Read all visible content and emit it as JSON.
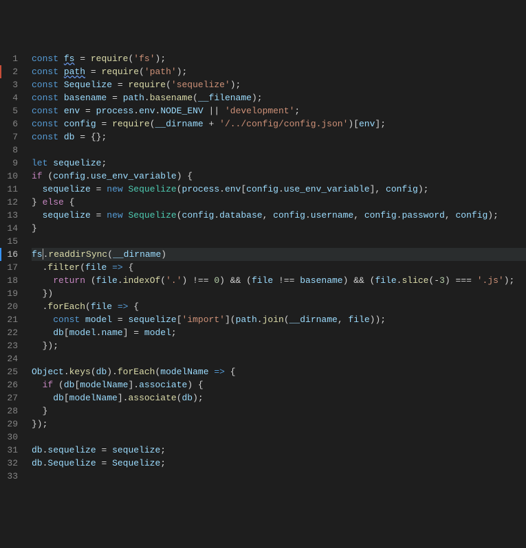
{
  "lines": [
    "1",
    "2",
    "3",
    "4",
    "5",
    "6",
    "7",
    "8",
    "9",
    "10",
    "11",
    "12",
    "13",
    "14",
    "15",
    "16",
    "17",
    "18",
    "19",
    "20",
    "21",
    "22",
    "23",
    "24",
    "25",
    "26",
    "27",
    "28",
    "29",
    "30",
    "31",
    "32",
    "33"
  ],
  "tokens": {
    "kw": {
      "const_": "const",
      "let_": "let",
      "if_": "if",
      "else_": "else",
      "new_": "new",
      "return_": "return"
    },
    "id": {
      "fs": "fs",
      "path": "path",
      "Sequelize": "Sequelize",
      "basename": "basename",
      "env": "env",
      "config": "config",
      "db": "db",
      "sequelize": "sequelize",
      "process": "process",
      "NODE_ENV": "NODE_ENV",
      "__filename": "__filename",
      "__dirname": "__dirname",
      "use_env_variable": "use_env_variable",
      "database": "database",
      "username": "username",
      "password": "password",
      "file": "file",
      "model": "model",
      "name": "name",
      "Object": "Object",
      "modelName": "modelName",
      "associate": "associate"
    },
    "fn": {
      "require": "require",
      "basename_fn": "basename",
      "readdirSync": "readdirSync",
      "filter": "filter",
      "indexOf": "indexOf",
      "slice": "slice",
      "forEach": "forEach",
      "join": "join",
      "keys": "keys"
    },
    "str": {
      "fs": "'fs'",
      "path": "'path'",
      "sequelize": "'sequelize'",
      "development": "'development'",
      "config_path": "'/../config/config.json'",
      "dot": "'.'",
      "js": "'.js'",
      "import": "'import'"
    },
    "num": {
      "zero": "0",
      "minus3": "3"
    }
  }
}
